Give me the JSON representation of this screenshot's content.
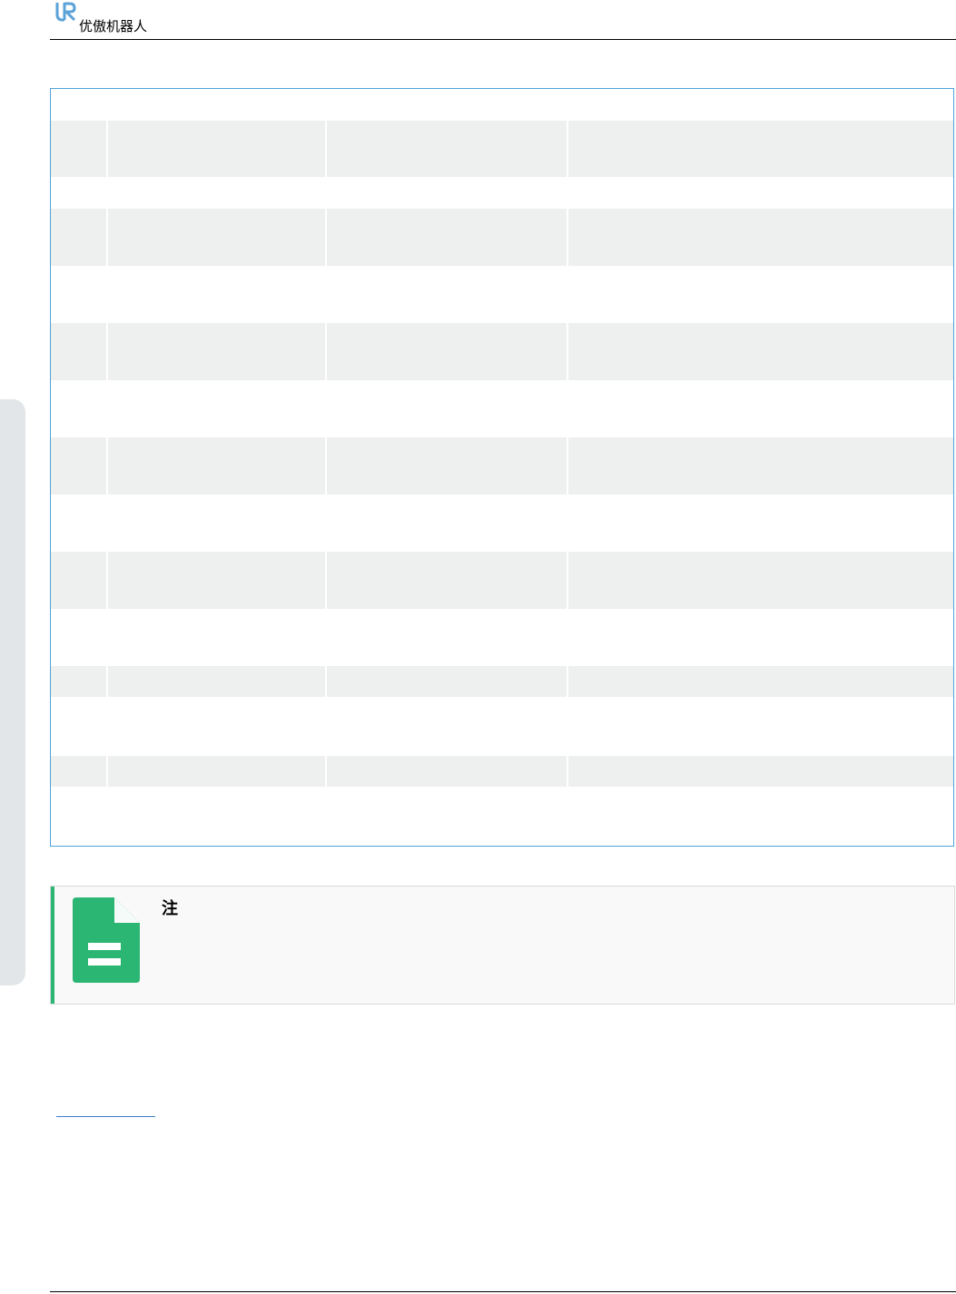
{
  "header": {
    "brand_name": "优傲机器人",
    "logo": "ur-logo",
    "accent_color": "#5aa2d8"
  },
  "table": {
    "border_color": "#4fa3d8",
    "row_shade_color": "#eef0ef",
    "rows": [
      {
        "shaded": false,
        "cells": [
          "",
          "",
          "",
          ""
        ]
      },
      {
        "shaded": true,
        "cells": [
          "",
          "",
          "",
          ""
        ]
      },
      {
        "shaded": false,
        "cells": [
          "",
          "",
          "",
          ""
        ]
      },
      {
        "shaded": true,
        "cells": [
          "",
          "",
          "",
          ""
        ]
      },
      {
        "shaded": false,
        "cells": [
          "",
          "",
          "",
          ""
        ]
      },
      {
        "shaded": true,
        "cells": [
          "",
          "",
          "",
          ""
        ]
      },
      {
        "shaded": false,
        "cells": [
          "",
          "",
          "",
          ""
        ]
      },
      {
        "shaded": true,
        "cells": [
          "",
          "",
          "",
          ""
        ]
      },
      {
        "shaded": false,
        "cells": [
          "",
          "",
          "",
          ""
        ]
      },
      {
        "shaded": true,
        "cells": [
          "",
          "",
          "",
          ""
        ]
      },
      {
        "shaded": false,
        "cells": [
          "",
          "",
          "",
          ""
        ]
      },
      {
        "shaded": true,
        "cells": [
          "",
          "",
          "",
          ""
        ]
      },
      {
        "shaded": false,
        "cells": [
          "",
          "",
          "",
          ""
        ]
      },
      {
        "shaded": true,
        "cells": [
          "",
          "",
          "",
          ""
        ]
      },
      {
        "shaded": false,
        "cells": [
          "",
          "",
          "",
          ""
        ]
      }
    ]
  },
  "note": {
    "title": "注",
    "body": "",
    "icon": "document-icon",
    "accent_color": "#2bb673"
  },
  "link": {
    "text": ""
  }
}
